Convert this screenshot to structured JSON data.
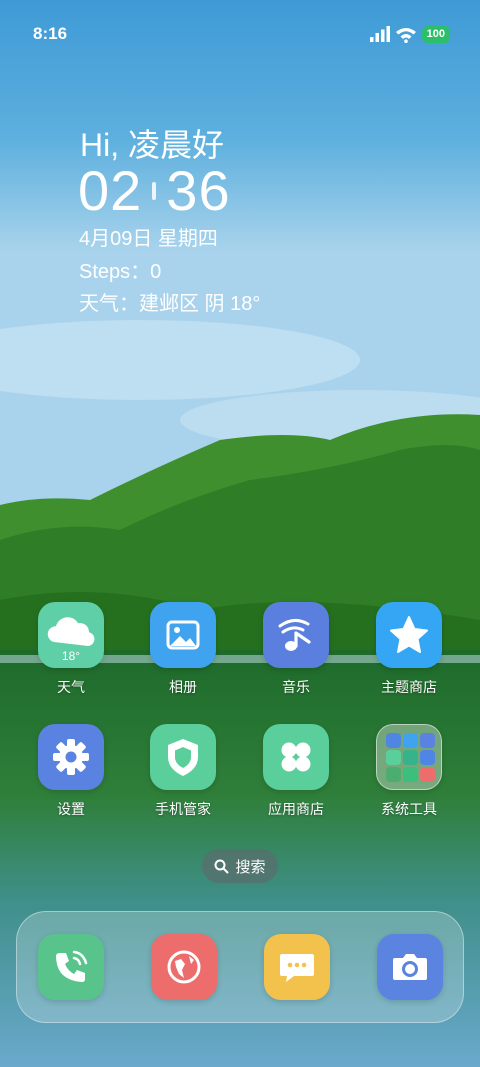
{
  "status_bar": {
    "time": "8:16",
    "battery_level": "100",
    "icons": [
      "signal-icon",
      "wifi-icon",
      "battery-icon"
    ]
  },
  "widget": {
    "greeting": "Hi, 凌晨好",
    "clock_hour": "02",
    "clock_minute": "36",
    "date": "4月09日 星期四",
    "steps": "Steps：0",
    "weather": "天气：建邺区 阴 18°"
  },
  "apps_row1": [
    {
      "label": "天气",
      "temp": "18°",
      "icon": "cloud-icon",
      "color": "#5ecfa6"
    },
    {
      "label": "相册",
      "icon": "image-icon",
      "color": "#3fa3f0"
    },
    {
      "label": "音乐",
      "icon": "music-note-icon",
      "color": "#5a7fde"
    },
    {
      "label": "主题商店",
      "icon": "star-icon",
      "color": "#35a6f3"
    }
  ],
  "apps_row2": [
    {
      "label": "设置",
      "icon": "gear-icon",
      "color": "#5a82e0"
    },
    {
      "label": "手机管家",
      "icon": "shield-icon",
      "color": "#5bcf9b"
    },
    {
      "label": "应用商店",
      "icon": "clover-icon",
      "color": "#5bcf9b"
    },
    {
      "label": "系统工具",
      "icon": "folder-icon",
      "color": "#ffffff"
    }
  ],
  "search": {
    "label": "搜索",
    "icon": "search-icon"
  },
  "dock": [
    {
      "name": "phone",
      "icon": "phone-icon",
      "color": "#58c48b"
    },
    {
      "name": "browser",
      "icon": "globe-icon",
      "color": "#ec6d6b"
    },
    {
      "name": "messages",
      "icon": "message-icon",
      "color": "#f2c24d"
    },
    {
      "name": "camera",
      "icon": "camera-icon",
      "color": "#5b83e0"
    }
  ]
}
